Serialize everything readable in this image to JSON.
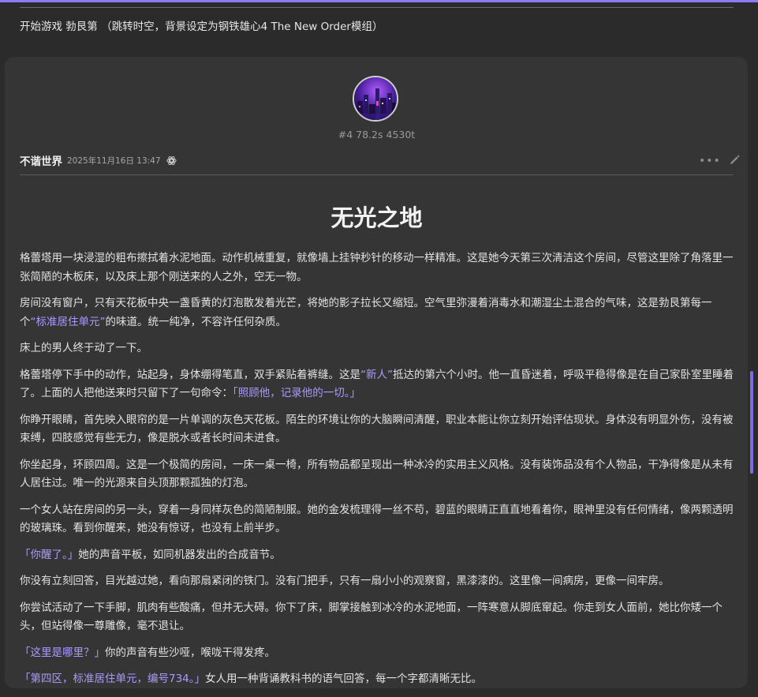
{
  "user_message": "开始游戏 勃艮第 （跳转时空，背景设定为钢铁雄心4 The New Order模组）",
  "message_meta": "#4 78.2s 4530t",
  "author": "不谐世界",
  "timestamp": "2025年11月16日 13:47",
  "icons": {
    "model": "openai-logo-icon",
    "more": "more-options-icon",
    "edit": "pencil-icon"
  },
  "colors": {
    "accent": "#8b7cf6",
    "highlight_text": "#a99bff",
    "background": "#2b2b2b",
    "card": "#353535"
  },
  "story": {
    "title": "无光之地",
    "paragraphs": [
      [
        {
          "text": "格蕾塔用一块浸湿的粗布擦拭着水泥地面。动作机械重复，就像墙上挂钟秒针的移动一样精准。这是她今天第三次清洁这个房间，尽管这里除了角落里一张简陋的木板床，以及床上那个刚送来的人之外，空无一物。",
          "hl": false
        }
      ],
      [
        {
          "text": "房间没有窗户，只有天花板中央一盏昏黄的灯泡散发着光芒，将她的影子拉长又缩短。空气里弥漫着消毒水和潮湿尘土混合的气味，这是勃艮第每一个",
          "hl": false
        },
        {
          "text": "“标准居住单元”",
          "hl": true
        },
        {
          "text": "的味道。统一纯净，不容许任何杂质。",
          "hl": false
        }
      ],
      [
        {
          "text": "床上的男人终于动了一下。",
          "hl": false
        }
      ],
      [
        {
          "text": "格蕾塔停下手中的动作，站起身，身体绷得笔直，双手紧贴着裤缝。这是",
          "hl": false
        },
        {
          "text": "“新人”",
          "hl": true
        },
        {
          "text": "抵达的第六个小时。他一直昏迷着，呼吸平稳得像是在自己家卧室里睡着了。上面的人把他送来时只留下了一句命令：",
          "hl": false
        },
        {
          "text": "「照顾他，记录他的一切。」",
          "hl": true
        }
      ],
      [
        {
          "text": "你睁开眼睛，首先映入眼帘的是一片单调的灰色天花板。陌生的环境让你的大脑瞬间清醒，职业本能让你立刻开始评估现状。身体没有明显外伤，没有被束缚，四肢感觉有些无力，像是脱水或者长时间未进食。",
          "hl": false
        }
      ],
      [
        {
          "text": "你坐起身，环顾四周。这是一个极简的房间，一床一桌一椅，所有物品都呈现出一种冰冷的实用主义风格。没有装饰品没有个人物品，干净得像是从未有人居住过。唯一的光源来自头顶那颗孤独的灯泡。",
          "hl": false
        }
      ],
      [
        {
          "text": "一个女人站在房间的另一头，穿着一身同样灰色的简陋制服。她的金发梳理得一丝不苟，碧蓝的眼睛正直直地看着你，眼神里没有任何情绪，像两颗透明的玻璃珠。看到你醒来，她没有惊讶，也没有上前半步。",
          "hl": false
        }
      ],
      [
        {
          "text": "「你醒了。」",
          "hl": true
        },
        {
          "text": "她的声音平板，如同机器发出的合成音节。",
          "hl": false
        }
      ],
      [
        {
          "text": "你没有立刻回答，目光越过她，看向那扇紧闭的铁门。没有门把手，只有一扇小小的观察窗，黑漆漆的。这里像一间病房，更像一间牢房。",
          "hl": false
        }
      ],
      [
        {
          "text": "你尝试活动了一下手脚，肌肉有些酸痛，但并无大碍。你下了床，脚掌接触到冰冷的水泥地面，一阵寒意从脚底窜起。你走到女人面前，她比你矮一个头，但站得像一尊雕像，毫不退让。",
          "hl": false
        }
      ],
      [
        {
          "text": "「这里是哪里？」",
          "hl": true
        },
        {
          "text": "你的声音有些沙哑，喉咙干得发疼。",
          "hl": false
        }
      ],
      [
        {
          "text": "「第四区，标准居住单元，编号734。」",
          "hl": true
        },
        {
          "text": "女人用一种背诵教科书的语气回答，每一个字都清晰无比。",
          "hl": false
        }
      ]
    ]
  }
}
